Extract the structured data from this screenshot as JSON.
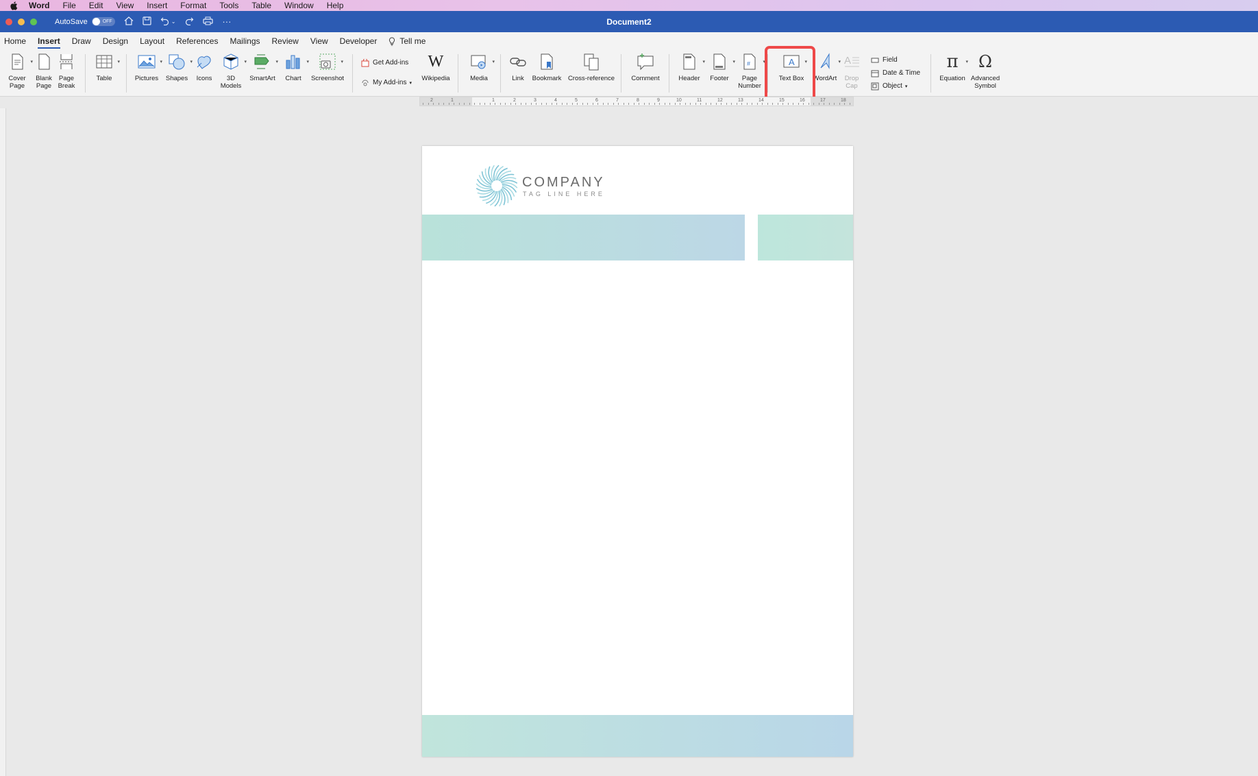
{
  "menubar": {
    "app": "Word",
    "items": [
      "File",
      "Edit",
      "View",
      "Insert",
      "Format",
      "Tools",
      "Table",
      "Window",
      "Help"
    ]
  },
  "titlebar": {
    "autosave_label": "AutoSave",
    "autosave_state": "OFF",
    "document_title": "Document2"
  },
  "tabs": [
    "Home",
    "Insert",
    "Draw",
    "Design",
    "Layout",
    "References",
    "Mailings",
    "Review",
    "View",
    "Developer",
    "Tell me"
  ],
  "active_tab": "Insert",
  "ribbon": {
    "cover_page": [
      "Cover",
      "Page"
    ],
    "blank_page": [
      "Blank",
      "Page"
    ],
    "page_break": [
      "Page",
      "Break"
    ],
    "table": "Table",
    "pictures": "Pictures",
    "shapes": "Shapes",
    "icons": "Icons",
    "models": [
      "3D",
      "Models"
    ],
    "smartart": "SmartArt",
    "chart": "Chart",
    "screenshot": "Screenshot",
    "get_addins": "Get Add-ins",
    "my_addins": "My Add-ins",
    "wikipedia": "Wikipedia",
    "media": "Media",
    "link": "Link",
    "bookmark": "Bookmark",
    "cross_reference": "Cross-reference",
    "comment": "Comment",
    "header": "Header",
    "footer": "Footer",
    "page_number": [
      "Page",
      "Number"
    ],
    "text_box": "Text Box",
    "wordart": "WordArt",
    "drop_cap": [
      "Drop",
      "Cap"
    ],
    "field": "Field",
    "date_time": "Date & Time",
    "object": "Object",
    "equation": "Equation",
    "advanced_symbol": [
      "Advanced",
      "Symbol"
    ]
  },
  "ruler_numbers": [
    "2",
    "1",
    "1",
    "2",
    "3",
    "4",
    "5",
    "6",
    "7",
    "8",
    "9",
    "10",
    "11",
    "12",
    "13",
    "14",
    "15",
    "16",
    "17",
    "18"
  ],
  "document": {
    "company": "COMPANY",
    "tagline": "TAG LINE HERE"
  },
  "colors": {
    "titlebar": "#2c5bb3",
    "highlight": "#ee4949",
    "band_teal": "#b9e2da",
    "band_blue": "#bcd7e6"
  }
}
